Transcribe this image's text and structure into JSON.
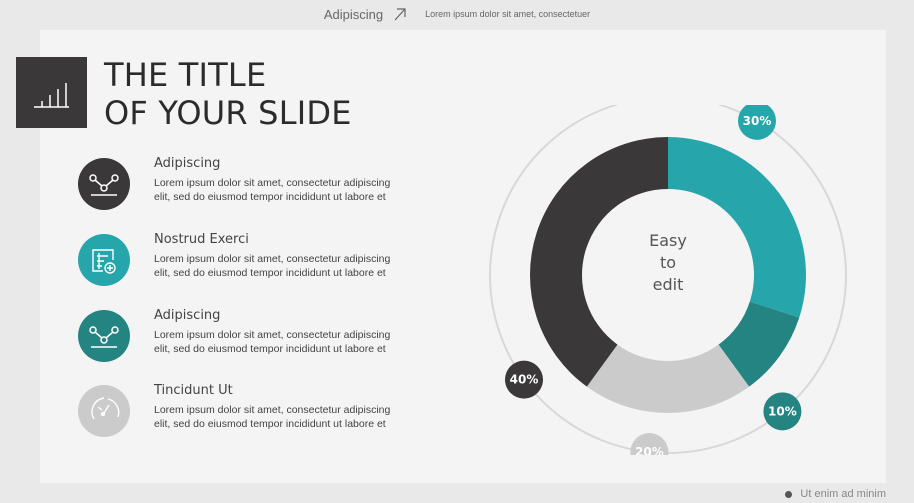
{
  "header": {
    "brand": "Adipiscing",
    "tagline": "Lorem ipsum dolor sit amet, consectetuer"
  },
  "slide": {
    "title_line1": "THE TITLE",
    "title_line2": "OF YOUR SLIDE"
  },
  "items": [
    {
      "heading": "Adipiscing",
      "line1": "Lorem ipsum dolor sit amet, consectetur adipiscing",
      "line2": "elit, sed do eiusmod tempor incididunt ut labore et",
      "color": "#3a3839",
      "icon": "line-graph-icon"
    },
    {
      "heading": "Nostrud Exerci",
      "line1": "Lorem ipsum dolor sit amet, consectetur adipiscing",
      "line2": "elit, sed do eiusmod tempor incididunt ut labore et",
      "color": "#26a6ab",
      "icon": "add-document-icon"
    },
    {
      "heading": "Adipiscing",
      "line1": "Lorem ipsum dolor sit amet, consectetur adipiscing",
      "line2": "elit, sed do eiusmod tempor incididunt ut labore et",
      "color": "#238482",
      "icon": "line-graph-icon"
    },
    {
      "heading": "Tincidunt Ut",
      "line1": "Lorem ipsum dolor sit amet, consectetur adipiscing",
      "line2": "elit, sed do eiusmod tempor incididunt ut labore et",
      "color": "#cccbcc",
      "icon": "gauge-icon"
    }
  ],
  "chart": {
    "center_line1": "Easy",
    "center_line2": "to",
    "center_line3": "edit"
  },
  "chart_data": {
    "type": "pie",
    "variant": "donut",
    "slices": [
      {
        "label": "30%",
        "value": 30,
        "color": "#26a6ab"
      },
      {
        "label": "10%",
        "value": 10,
        "color": "#238482"
      },
      {
        "label": "20%",
        "value": 20,
        "color": "#cccbcc"
      },
      {
        "label": "40%",
        "value": 40,
        "color": "#3a3839"
      }
    ]
  },
  "footer": {
    "text": "Ut enim ad minim"
  }
}
